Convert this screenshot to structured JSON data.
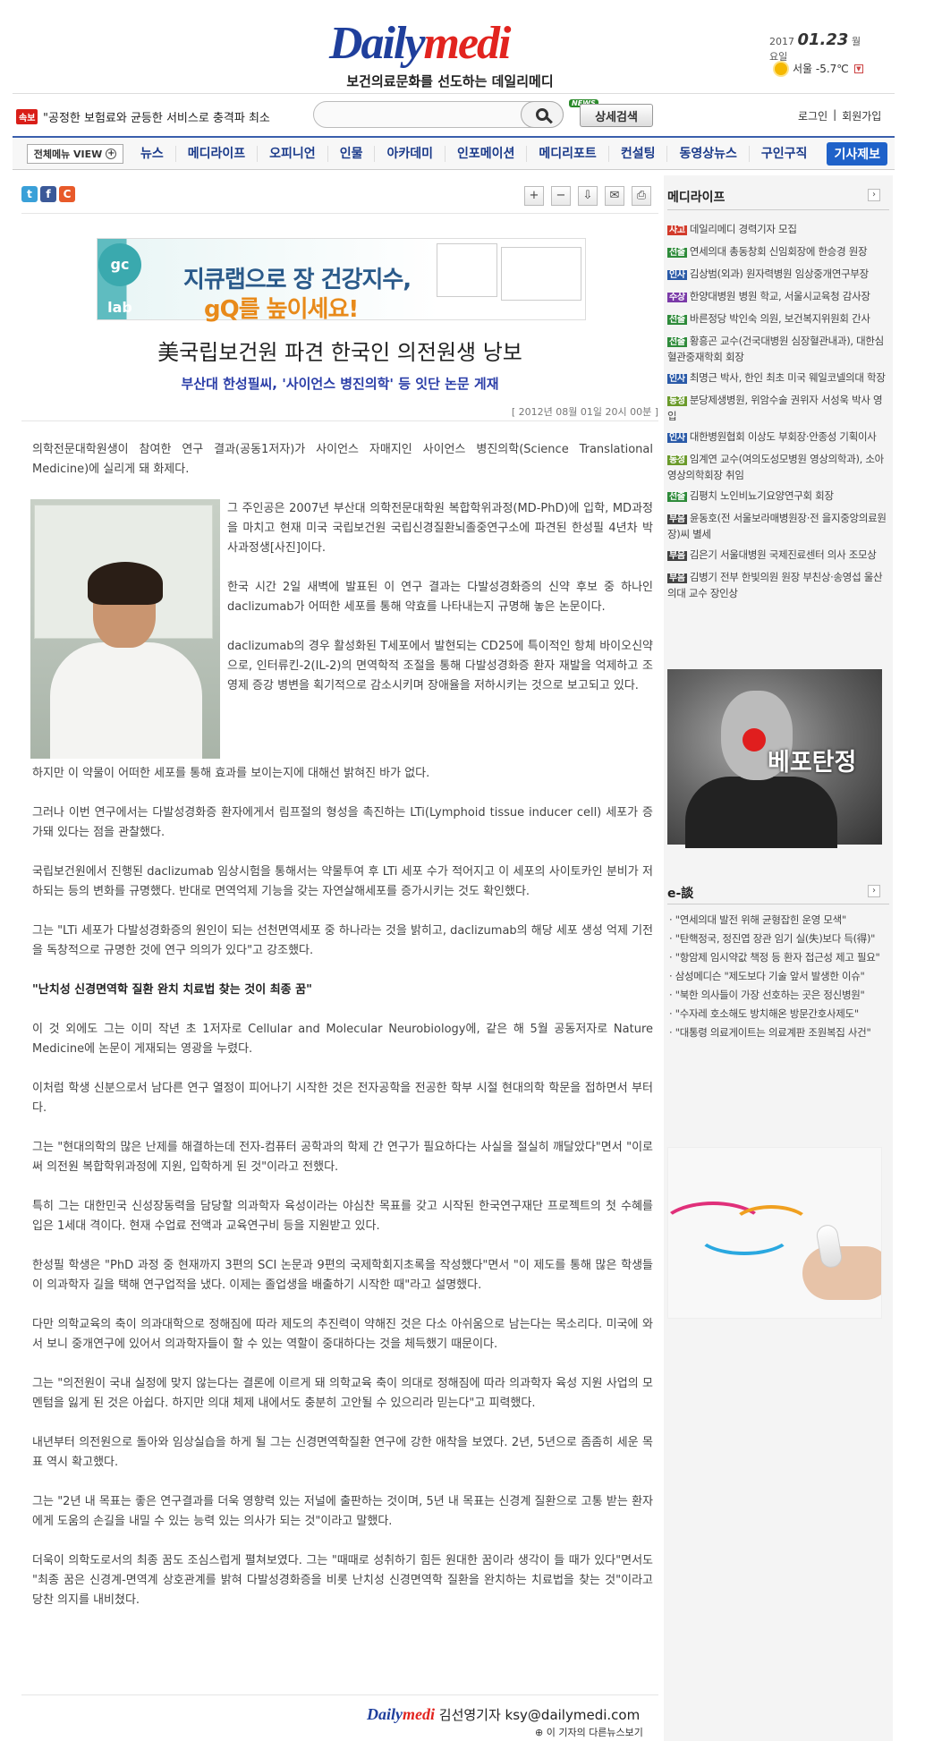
{
  "header": {
    "logo_part1": "Daily",
    "logo_part2": "medi",
    "tagline": "보건의료문화를 선도하는 데일리메디",
    "date_year": "2017",
    "date_md": "01.23",
    "date_weekday": "월요일",
    "weather": "서울 -5.7℃",
    "breaking_badge": "속보",
    "breaking_text": "\"공정한 보험료와 균등한 서비스로 충격파 최소",
    "search_placeholder": "",
    "news_badge": "NEWS",
    "detail_search": "상세검색",
    "login": "로그인",
    "join": "회원가입",
    "separator": "|"
  },
  "nav": {
    "all_menu": "전체메뉴 VIEW",
    "items": [
      "뉴스",
      "메디라이프",
      "오피니언",
      "인물",
      "아카데미",
      "인포메이션",
      "메디리포트",
      "컨설팅",
      "동영상뉴스",
      "구인구직"
    ],
    "report": "기사제보"
  },
  "article_tools": [
    "+",
    "−",
    "⇩",
    "✉",
    "⎙"
  ],
  "ad": {
    "logo": "gc lab",
    "line1": "지큐랩으로 장 건강지수,",
    "line2": "gQ를 높이세요!"
  },
  "article": {
    "headline": "美국립보건원 파견 한국인 의전원생 낭보",
    "subtitle": "부산대 한성필씨, '사이언스 병진의학' 등 잇단 논문 게재",
    "dateline": "[ 2012년 08월 01일 20시 00분 ]",
    "p0": "의학전문대학원생이 참여한 연구 결과(공동1저자)가 사이언스 자매지인 사이언스 병진의학(Science Translational Medicine)에 실리게 돼 화제다.",
    "p1": "그 주인공은 2007년 부산대 의학전문대학원 복합학위과정(MD-PhD)에 입학, MD과정을 마치고 현재 미국 국립보건원 국립신경질환뇌졸중연구소에 파견된 한성필 4년차 박사과정생[사진]이다.",
    "p2": "한국 시간 2일 새벽에 발표된 이 연구 결과는 다발성경화증의 신약 후보 중 하나인 daclizumab가 어떠한 세포를 통해 약효를 나타내는지 규명해 놓은 논문이다.",
    "p3": "daclizumab의 경우 활성화된 T세포에서 발현되는 CD25에 특이적인 항체 바이오신약으로, 인터류킨-2(IL-2)의 면역학적 조절을 통해 다발성경화증 환자 재발을 억제하고 조영제 증강 병변을 획기적으로 감소시키며 장애율을 저하시키는 것으로 보고되고 있다.",
    "p4": "하지만 이 약물이 어떠한 세포를 통해 효과를 보이는지에 대해선 밝혀진 바가 없다.",
    "p5": "그러나 이번 연구에서는 다발성경화증 환자에게서 림프절의 형성을 촉진하는 LTi(Lymphoid tissue inducer cell) 세포가 증가돼 있다는 점을 관찰했다.",
    "p6": "국립보건원에서 진행된 daclizumab 임상시험을 통해서는 약물투여 후 LTi 세포 수가 적어지고 이 세포의 사이토카인 분비가 저하되는 등의 변화를 규명했다. 반대로 면역억제 기능을 갖는 자연살해세포를 증가시키는 것도 확인했다.",
    "p7": "그는 \"LTi 세포가 다발성경화증의 원인이 되는 선천면역세포 중 하나라는 것을 밝히고, daclizumab의 해당 세포 생성 억제 기전을 독창적으로 규명한 것에 연구 의의가 있다\"고 강조했다.",
    "p8": "\"난치성 신경면역학 질환 완치 치료법 찾는 것이 최종 꿈\"",
    "p9": "이 것 외에도 그는 이미 작년 초 1저자로 Cellular and Molecular Neurobiology에, 같은 해 5월 공동저자로 Nature Medicine에 논문이 게재되는 영광을 누렸다.",
    "p10": "이처럼 학생 신분으로서 남다른 연구 열정이 피어나기 시작한 것은 전자공학을 전공한 학부 시절 현대의학 학문을 접하면서 부터다.",
    "p11": "그는 \"현대의학의 많은 난제를 해결하는데 전자-컴퓨터 공학과의 학제 간 연구가 필요하다는 사실을 절실히 깨달았다\"면서 \"이로써 의전원 복합학위과정에 지원, 입학하게 된 것\"이라고 전했다.",
    "p12": "특히 그는 대한민국 신성장동력을 담당할 의과학자 육성이라는 야심찬 목표를 갖고 시작된 한국연구재단 프로젝트의 첫 수혜를 입은 1세대 격이다. 현재 수업료 전액과 교육연구비 등을 지원받고 있다.",
    "p13": "한성필 학생은 \"PhD 과정 중 현재까지 3편의 SCI 논문과 9편의 국제학회지초록을 작성했다\"면서 \"이 제도를 통해 많은 학생들이 의과학자 길을 택해 연구업적을 냈다. 이제는 졸업생을 배출하기 시작한 때\"라고 설명했다.",
    "p14": "다만 의학교육의 축이 의과대학으로 정해짐에 따라 제도의 추진력이 약해진 것은 다소 아쉬움으로 남는다는 목소리다. 미국에 와서 보니 중개연구에 있어서 의과학자들이 할 수 있는 역할이 중대하다는 것을 체득했기 때문이다.",
    "p15": "그는 \"의전원이 국내 실정에 맞지 않는다는 결론에 이르게 돼 의학교육 축이 의대로 정해짐에 따라 의과학자 육성 지원 사업의 모멘텀을 잃게 된 것은 아쉽다. 하지만 의대 체제 내에서도 충분히 고안될 수 있으리라 믿는다\"고 피력했다.",
    "p16": "내년부터 의전원으로 돌아와 임상실습을 하게 될 그는 신경면역학질환 연구에 강한 애착을 보였다. 2년, 5년으로 좀좀히 세운 목표 역시 확고했다.",
    "p17": "그는 \"2년 내 목표는 좋은 연구결과를 더욱 영향력 있는 저널에 출판하는 것이며, 5년 내 목표는 신경계 질환으로 고통 받는 환자에게 도움의 손길을 내밀 수 있는 능력 있는 의사가 되는 것\"이라고 말했다.",
    "p18": "더욱이 의학도로서의 최종 꿈도 조심스럽게 펼쳐보였다. 그는 \"때때로 성취하기 힘든 원대한 꿈이라 생각이 들 때가 있다\"면서도 \"최종 꿈은 신경계-면역계 상호관계를 밝혀 다발성경화증을 비롯 난치성 신경면역학 질환을 완치하는 치료법을 찾는 것\"이라고 당찬 의지를 내비쳤다.",
    "byline_logo1": "Daily",
    "byline_logo2": "medi",
    "byline": "김선영기자 ksy@dailymedi.com",
    "more_news": "이 기자의 다른뉴스보기"
  },
  "sidebar": {
    "medilife_title": "메디라이프",
    "medilife": [
      {
        "tag": "사고",
        "color": "#d23a2a",
        "text": "데일리메디 경력기자 모집"
      },
      {
        "tag": "선출",
        "color": "#2e8b3a",
        "text": "연세의대 총동창회 신임회장에 한승경 원장"
      },
      {
        "tag": "인사",
        "color": "#2a5aa8",
        "text": "김상범(외과) 원자력병원 임상중개연구부장"
      },
      {
        "tag": "수상",
        "color": "#7a3aa8",
        "text": "한양대병원 병원 학교, 서울시교육청 감사장"
      },
      {
        "tag": "선출",
        "color": "#2e8b3a",
        "text": "바른정당 박인숙 의원, 보건복지위원회 간사"
      },
      {
        "tag": "선출",
        "color": "#2e8b3a",
        "text": "황흥곤 교수(건국대병원 심장혈관내과), 대한심혈관중재학회 회장"
      },
      {
        "tag": "인사",
        "color": "#2a5aa8",
        "text": "최명근 박사, 한인 최초 미국 웨일코넬의대 학장"
      },
      {
        "tag": "동정",
        "color": "#6a9a2a",
        "text": "분당제생병원, 위암수술 권위자 서성욱 박사 영입"
      },
      {
        "tag": "인사",
        "color": "#2a5aa8",
        "text": "대한병원협회 이상도 부회장·안종성 기획이사"
      },
      {
        "tag": "동정",
        "color": "#6a9a2a",
        "text": "임계연 교수(여의도성모병원 영상의학과), 소아영상의학회장 취임"
      },
      {
        "tag": "선출",
        "color": "#2e8b3a",
        "text": "김평치 노인비뇨기요양연구회 회장"
      },
      {
        "tag": "부음",
        "color": "#444444",
        "text": "윤동호(전 서울보라매병원장·전 을지중앙의료원장)씨 별세"
      },
      {
        "tag": "부음",
        "color": "#444444",
        "text": "김은기 서울대병원 국제진료센터 의사 조모상"
      },
      {
        "tag": "부음",
        "color": "#444444",
        "text": "김병기 전부 한빛의원 원장 부친상·송영섭 울산의대 교수 장인상"
      }
    ],
    "promo_label": "베포탄정",
    "edam_title": "e-談",
    "edam": [
      "\"연세의대 발전 위해 균형잡힌 운영 모색\"",
      "\"탄핵정국, 정진엽 장관 임기 실(失)보다 득(得)\"",
      "\"항암제 임시약값 책정 등 환자 접근성 제고 필요\"",
      "삼성메디슨 \"제도보다 기술 앞서 발생한 이슈\"",
      "\"북한 의사들이 가장 선호하는 곳은 정신병원\"",
      "\"수자레 호소해도 방치해온 방문간호사제도\"",
      "\"대통령 의료게이트는 의료계판 조원복집 사건\""
    ]
  }
}
